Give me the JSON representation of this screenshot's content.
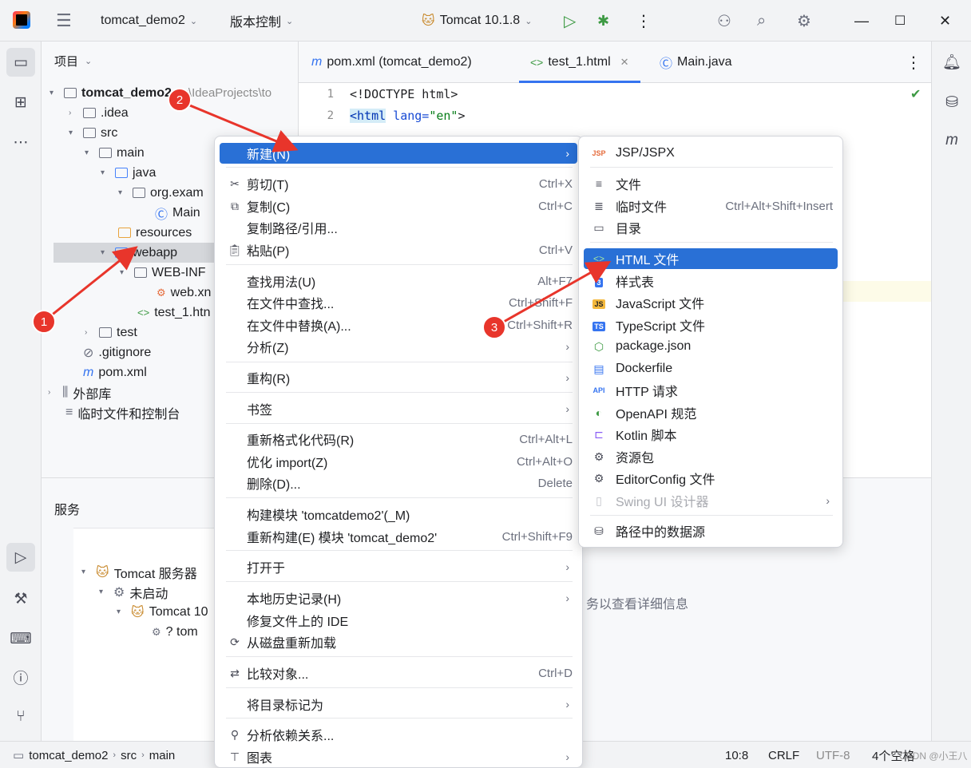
{
  "titlebar": {
    "project": "tomcat_demo2",
    "vcs": "版本控制",
    "run_config": "Tomcat 10.1.8"
  },
  "project_panel": {
    "title": "项目",
    "tree": [
      {
        "label": "tomcat_demo2",
        "path": "D:\\IdeaProjects\\to"
      },
      {
        "label": ".idea"
      },
      {
        "label": "src"
      },
      {
        "label": "main"
      },
      {
        "label": "java"
      },
      {
        "label": "org.exam"
      },
      {
        "label": "Main"
      },
      {
        "label": "resources"
      },
      {
        "label": "webapp"
      },
      {
        "label": "WEB-INF"
      },
      {
        "label": "web.xn"
      },
      {
        "label": "test_1.htn"
      },
      {
        "label": "test"
      },
      {
        "label": ".gitignore"
      },
      {
        "label": "pom.xml"
      },
      {
        "label": "外部库"
      },
      {
        "label": "临时文件和控制台"
      }
    ]
  },
  "tabs": [
    {
      "label": "pom.xml (tomcat_demo2)"
    },
    {
      "label": "test_1.html"
    },
    {
      "label": "Main.java"
    }
  ],
  "editor": {
    "line_numbers": [
      "1",
      "2"
    ],
    "line1": "<!DOCTYPE html>",
    "line2_tag": "<html",
    "line2_attr": " lang=",
    "line2_val": "\"en\"",
    "line2_end": ">"
  },
  "services": {
    "title": "服务",
    "tree": [
      "Tomcat 服务器",
      "未启动",
      "Tomcat 10",
      "? tom"
    ],
    "hint": "务以查看详细信息"
  },
  "statusbar": {
    "crumbs": [
      "tomcat_demo2",
      "src",
      "main"
    ],
    "position": "10:8",
    "line_sep": "CRLF",
    "encoding": "UTF-8",
    "indent": "4个空格",
    "watermark": "CSDN @小王八"
  },
  "context_menu": [
    {
      "label": "新建(N)",
      "shortcut": "",
      "submenu": true
    },
    {
      "label": "剪切(T)",
      "shortcut": "Ctrl+X"
    },
    {
      "label": "复制(C)",
      "shortcut": "Ctrl+C"
    },
    {
      "label": "复制路径/引用...",
      "shortcut": ""
    },
    {
      "label": "粘贴(P)",
      "shortcut": "Ctrl+V"
    },
    {
      "label": "查找用法(U)",
      "shortcut": "Alt+F7"
    },
    {
      "label": "在文件中查找...",
      "shortcut": "Ctrl+Shift+F"
    },
    {
      "label": "在文件中替换(A)...",
      "shortcut": "Ctrl+Shift+R"
    },
    {
      "label": "分析(Z)",
      "shortcut": "",
      "submenu": true
    },
    {
      "label": "重构(R)",
      "shortcut": "",
      "submenu": true
    },
    {
      "label": "书签",
      "shortcut": "",
      "submenu": true
    },
    {
      "label": "重新格式化代码(R)",
      "shortcut": "Ctrl+Alt+L"
    },
    {
      "label": "优化 import(Z)",
      "shortcut": "Ctrl+Alt+O"
    },
    {
      "label": "删除(D)...",
      "shortcut": "Delete"
    },
    {
      "label": "构建模块 'tomcatdemo2'(_M)",
      "shortcut": ""
    },
    {
      "label": "重新构建(E) 模块 'tomcat_demo2'",
      "shortcut": "Ctrl+Shift+F9"
    },
    {
      "label": "打开于",
      "shortcut": "",
      "submenu": true
    },
    {
      "label": "本地历史记录(H)",
      "shortcut": "",
      "submenu": true
    },
    {
      "label": "修复文件上的 IDE",
      "shortcut": ""
    },
    {
      "label": "从磁盘重新加载",
      "shortcut": ""
    },
    {
      "label": "比较对象...",
      "shortcut": "Ctrl+D"
    },
    {
      "label": "将目录标记为",
      "shortcut": "",
      "submenu": true
    },
    {
      "label": "分析依赖关系...",
      "shortcut": ""
    },
    {
      "label": "图表",
      "shortcut": "",
      "submenu": true
    }
  ],
  "new_submenu": [
    {
      "label": "JSP/JSPX",
      "shortcut": ""
    },
    {
      "label": "文件",
      "shortcut": ""
    },
    {
      "label": "临时文件",
      "shortcut": "Ctrl+Alt+Shift+Insert"
    },
    {
      "label": "目录",
      "shortcut": ""
    },
    {
      "label": "HTML 文件",
      "shortcut": ""
    },
    {
      "label": "样式表",
      "shortcut": ""
    },
    {
      "label": "JavaScript 文件",
      "shortcut": ""
    },
    {
      "label": "TypeScript 文件",
      "shortcut": ""
    },
    {
      "label": "package.json",
      "shortcut": ""
    },
    {
      "label": "Dockerfile",
      "shortcut": ""
    },
    {
      "label": "HTTP 请求",
      "shortcut": ""
    },
    {
      "label": "OpenAPI 规范",
      "shortcut": ""
    },
    {
      "label": "Kotlin 脚本",
      "shortcut": ""
    },
    {
      "label": "资源包",
      "shortcut": ""
    },
    {
      "label": "EditorConfig 文件",
      "shortcut": ""
    },
    {
      "label": "Swing UI 设计器",
      "shortcut": "",
      "submenu": true
    },
    {
      "label": "路径中的数据源",
      "shortcut": ""
    }
  ],
  "annotations": [
    "1",
    "2",
    "3"
  ],
  "colors": {
    "highlight": "#2970d6",
    "accent": "#3574f0",
    "marker": "#e8352b"
  }
}
